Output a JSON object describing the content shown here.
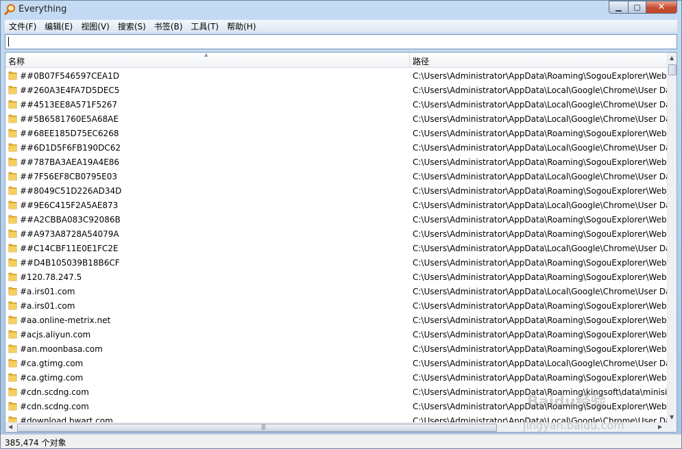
{
  "window": {
    "title": "Everything"
  },
  "menu": [
    "文件(F)",
    "编辑(E)",
    "视图(V)",
    "搜索(S)",
    "书签(B)",
    "工具(T)",
    "帮助(H)"
  ],
  "search": {
    "value": "",
    "placeholder": ""
  },
  "columns": {
    "name": "名称",
    "path": "路径"
  },
  "rows": [
    {
      "name": "##0B07F546597CEA1D",
      "path": "C:\\Users\\Administrator\\AppData\\Roaming\\SogouExplorer\\Web"
    },
    {
      "name": "##260A3E4FA7D5DEC5",
      "path": "C:\\Users\\Administrator\\AppData\\Local\\Google\\Chrome\\User Da"
    },
    {
      "name": "##4513EE8A571F5267",
      "path": "C:\\Users\\Administrator\\AppData\\Local\\Google\\Chrome\\User Da"
    },
    {
      "name": "##5B6581760E5A68AE",
      "path": "C:\\Users\\Administrator\\AppData\\Local\\Google\\Chrome\\User Da"
    },
    {
      "name": "##68EE185D75EC6268",
      "path": "C:\\Users\\Administrator\\AppData\\Roaming\\SogouExplorer\\Web"
    },
    {
      "name": "##6D1D5F6FB190DC62",
      "path": "C:\\Users\\Administrator\\AppData\\Local\\Google\\Chrome\\User Da"
    },
    {
      "name": "##787BA3AEA19A4E86",
      "path": "C:\\Users\\Administrator\\AppData\\Roaming\\SogouExplorer\\Web"
    },
    {
      "name": "##7F56EF8CB0795E03",
      "path": "C:\\Users\\Administrator\\AppData\\Local\\Google\\Chrome\\User Da"
    },
    {
      "name": "##8049C51D226AD34D",
      "path": "C:\\Users\\Administrator\\AppData\\Roaming\\SogouExplorer\\Web"
    },
    {
      "name": "##9E6C415F2A5AE873",
      "path": "C:\\Users\\Administrator\\AppData\\Local\\Google\\Chrome\\User Da"
    },
    {
      "name": "##A2CBBA083C92086B",
      "path": "C:\\Users\\Administrator\\AppData\\Roaming\\SogouExplorer\\Web"
    },
    {
      "name": "##A973A8728A54079A",
      "path": "C:\\Users\\Administrator\\AppData\\Roaming\\SogouExplorer\\Web"
    },
    {
      "name": "##C14CBF11E0E1FC2E",
      "path": "C:\\Users\\Administrator\\AppData\\Local\\Google\\Chrome\\User Da"
    },
    {
      "name": "##D4B105039B18B6CF",
      "path": "C:\\Users\\Administrator\\AppData\\Roaming\\SogouExplorer\\Web"
    },
    {
      "name": "#120.78.247.5",
      "path": "C:\\Users\\Administrator\\AppData\\Roaming\\SogouExplorer\\Web"
    },
    {
      "name": "#a.irs01.com",
      "path": "C:\\Users\\Administrator\\AppData\\Local\\Google\\Chrome\\User Da"
    },
    {
      "name": "#a.irs01.com",
      "path": "C:\\Users\\Administrator\\AppData\\Roaming\\SogouExplorer\\Web"
    },
    {
      "name": "#aa.online-metrix.net",
      "path": "C:\\Users\\Administrator\\AppData\\Roaming\\SogouExplorer\\Web"
    },
    {
      "name": "#acjs.aliyun.com",
      "path": "C:\\Users\\Administrator\\AppData\\Roaming\\SogouExplorer\\Web"
    },
    {
      "name": "#an.moonbasa.com",
      "path": "C:\\Users\\Administrator\\AppData\\Roaming\\SogouExplorer\\Web"
    },
    {
      "name": "#ca.gtimg.com",
      "path": "C:\\Users\\Administrator\\AppData\\Local\\Google\\Chrome\\User Da"
    },
    {
      "name": "#ca.gtimg.com",
      "path": "C:\\Users\\Administrator\\AppData\\Roaming\\SogouExplorer\\Web"
    },
    {
      "name": "#cdn.scdng.com",
      "path": "C:\\Users\\Administrator\\AppData\\Roaming\\kingsoft\\data\\minisit"
    },
    {
      "name": "#cdn.scdng.com",
      "path": "C:\\Users\\Administrator\\AppData\\Roaming\\SogouExplorer\\Web"
    },
    {
      "name": "#download.bwart.com",
      "path": "C:\\Users\\Administrator\\AppData\\Local\\Google\\Chrome\\User Da"
    }
  ],
  "status": {
    "text": "385,474 个对象"
  },
  "watermark": {
    "main": "Baidu经验",
    "sub": "jingyan.baidu.com"
  },
  "colors": {
    "folder": "#e8b534",
    "titlebar": "#c5dbf2",
    "close_button": "#c8452a"
  }
}
